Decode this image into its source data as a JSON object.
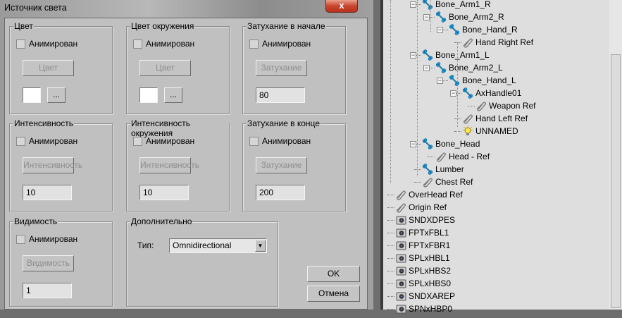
{
  "dialog": {
    "title": "Источник света",
    "close": "x",
    "groups": {
      "color": {
        "label": "Цвет",
        "animated": "Анимирован",
        "button": "Цвет",
        "more": "..."
      },
      "ambient": {
        "label": "Цвет окружения",
        "animated": "Анимирован",
        "button": "Цвет",
        "more": "..."
      },
      "atten_start": {
        "label": "Затухание в начале",
        "animated": "Анимирован",
        "button": "Затухание",
        "value": "80"
      },
      "intensity": {
        "label": "Интенсивность",
        "animated": "Анимирован",
        "button": "Интенсивность",
        "value": "10"
      },
      "amb_intensity": {
        "label": "Интенсивность окружения",
        "animated": "Анимирован",
        "button": "Интенсивность",
        "value": "10"
      },
      "atten_end": {
        "label": "Затухание в конце",
        "animated": "Анимирован",
        "button": "Затухание",
        "value": "200"
      },
      "visibility": {
        "label": "Видимость",
        "animated": "Анимирован",
        "button": "Видимость",
        "value": "1"
      },
      "extra": {
        "label": "Дополнительно",
        "type_label": "Тип:",
        "type_value": "Omnidirectional"
      }
    },
    "ok": "OK",
    "cancel": "Отмена"
  },
  "tree": [
    {
      "label": "Bone_Arm1_R",
      "level": 2,
      "icon": "bone",
      "exp": true
    },
    {
      "label": "Bone_Arm2_R",
      "level": 3,
      "icon": "bone",
      "exp": true
    },
    {
      "label": "Bone_Hand_R",
      "level": 4,
      "icon": "bone",
      "exp": true
    },
    {
      "label": "Hand Right Ref",
      "level": 5,
      "icon": "clip"
    },
    {
      "label": "Bone_Arm1_L",
      "level": 2,
      "icon": "bone",
      "exp": true
    },
    {
      "label": "Bone_Arm2_L",
      "level": 3,
      "icon": "bone",
      "exp": true
    },
    {
      "label": "Bone_Hand_L",
      "level": 4,
      "icon": "bone",
      "exp": true
    },
    {
      "label": "AxHandle01",
      "level": 5,
      "icon": "bone",
      "exp": true
    },
    {
      "label": "Weapon Ref",
      "level": 6,
      "icon": "clip"
    },
    {
      "label": "Hand Left Ref",
      "level": 5,
      "icon": "clip"
    },
    {
      "label": "UNNAMED",
      "level": 5,
      "icon": "light"
    },
    {
      "label": "Bone_Head",
      "level": 2,
      "icon": "bone",
      "exp": true
    },
    {
      "label": "Head - Ref",
      "level": 3,
      "icon": "clip"
    },
    {
      "label": "Lumber",
      "level": 2,
      "icon": "bone"
    },
    {
      "label": "Chest Ref",
      "level": 2,
      "icon": "clip"
    },
    {
      "label": "OverHead Ref",
      "level": 0,
      "icon": "clip"
    },
    {
      "label": "Origin Ref",
      "level": 0,
      "icon": "clip"
    },
    {
      "label": "SNDXDPES",
      "level": 0,
      "icon": "camera"
    },
    {
      "label": "FPTxFBL1",
      "level": 0,
      "icon": "camera"
    },
    {
      "label": "FPTxFBR1",
      "level": 0,
      "icon": "camera"
    },
    {
      "label": "SPLxHBL1",
      "level": 0,
      "icon": "camera"
    },
    {
      "label": "SPLxHBS2",
      "level": 0,
      "icon": "camera"
    },
    {
      "label": "SPLxHBS0",
      "level": 0,
      "icon": "camera"
    },
    {
      "label": "SNDXAREP",
      "level": 0,
      "icon": "camera"
    },
    {
      "label": "SPNxHBP0",
      "level": 0,
      "icon": "camera"
    }
  ],
  "colors": {
    "bone": "#1a9ee0",
    "client": "#c0c0c0",
    "tree_bg": "#dedede"
  }
}
